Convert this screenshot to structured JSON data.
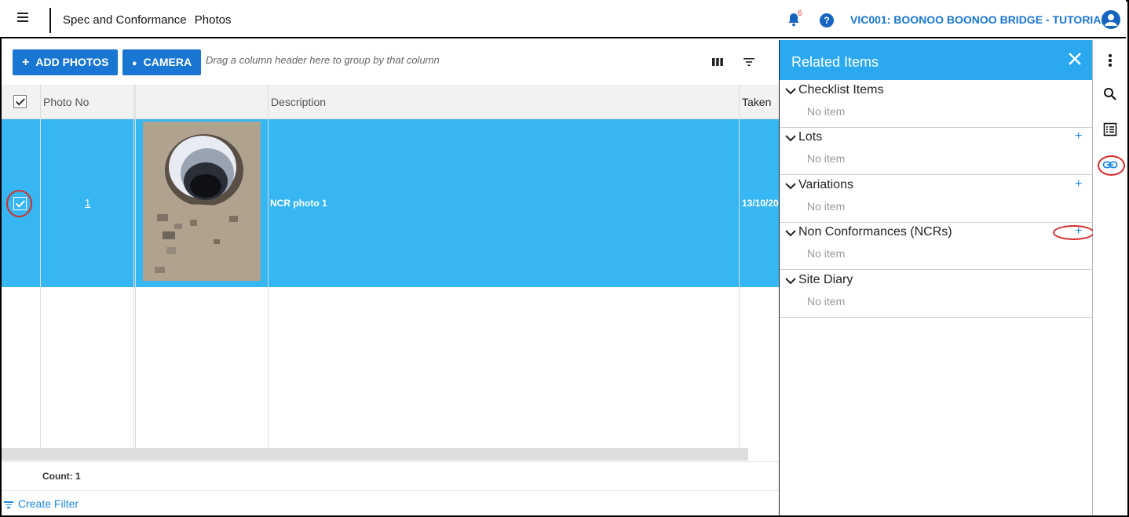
{
  "header": {
    "breadcrumb": [
      "Spec and Conformance",
      "Photos"
    ],
    "notification_count": "6",
    "help_label": "?",
    "project": "VIC001: BOONOO BOONOO BRIDGE - TUTORIAL"
  },
  "toolbar": {
    "add_photos_label": "ADD PHOTOS",
    "camera_label": "CAMERA",
    "group_hint": "Drag a column header here to group by that column"
  },
  "grid": {
    "columns": [
      "Photo No",
      "",
      "Description",
      "Taken"
    ],
    "rows": [
      {
        "photo_no": "1",
        "description": "NCR photo 1",
        "taken": "13/10/20"
      }
    ],
    "count_label": "Count: 1",
    "create_filter_label": "Create Filter"
  },
  "related": {
    "title": "Related Items",
    "sections": [
      {
        "title": "Checklist Items",
        "empty": "No item",
        "can_add": false
      },
      {
        "title": "Lots",
        "empty": "No item",
        "can_add": true
      },
      {
        "title": "Variations",
        "empty": "No item",
        "can_add": true
      },
      {
        "title": "Non Conformances (NCRs)",
        "empty": "No item",
        "can_add": true
      },
      {
        "title": "Site Diary",
        "empty": "No item",
        "can_add": false
      }
    ]
  },
  "colors": {
    "primary": "#1976d2",
    "selected_row": "#36b6f2",
    "panel_header": "#2aa8f0",
    "highlight_ring": "#d32f2f"
  }
}
